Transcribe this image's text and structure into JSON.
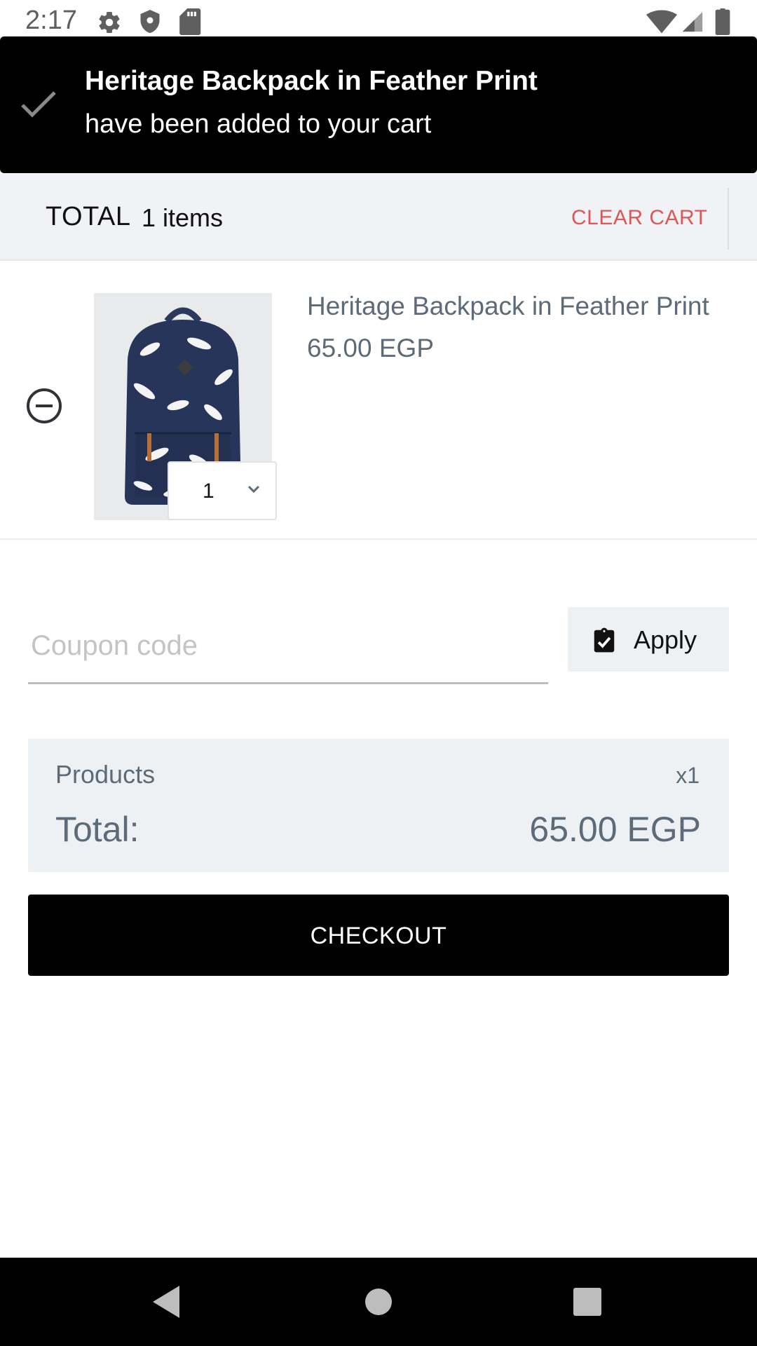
{
  "status_bar": {
    "time": "2:17",
    "icons": [
      "settings-icon",
      "shield-icon",
      "sd-card-icon",
      "wifi-icon",
      "signal-icon",
      "battery-icon"
    ]
  },
  "toast": {
    "icon": "checkmark-icon",
    "title": "Heritage Backpack in Feather Print",
    "message": "have been added to your cart"
  },
  "cart_header": {
    "total_label": "TOTAL",
    "item_count": "1 items",
    "clear_cart_label": "CLEAR CART"
  },
  "cart_items": [
    {
      "name": "Heritage Backpack in Feather Print",
      "price": "65.00 EGP",
      "quantity": "1",
      "image": "navy feather print backpack"
    }
  ],
  "coupon": {
    "placeholder": "Coupon code",
    "value": "",
    "apply_label": "Apply"
  },
  "summary": {
    "products_label": "Products",
    "products_count": "x1",
    "total_label": "Total:",
    "total_value": "65.00 EGP"
  },
  "checkout": {
    "label": "CHECKOUT"
  },
  "colors": {
    "accent_red": "#e05656",
    "muted_text": "#5d6b78",
    "panel_bg": "#eef1f4",
    "black": "#000000"
  },
  "nav_bar": {
    "buttons": [
      "back-icon",
      "home-icon",
      "recents-icon"
    ]
  }
}
